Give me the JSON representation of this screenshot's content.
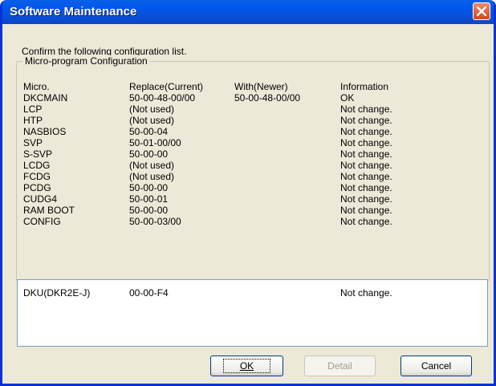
{
  "window": {
    "title": "Software Maintenance"
  },
  "prompt": "Confirm the following configuration list.",
  "group": {
    "legend": "Micro-program Configuration"
  },
  "columns": [
    "Micro.",
    "Replace(Current)",
    "With(Newer)",
    "Information"
  ],
  "rows": [
    [
      "DKCMAIN",
      "50-00-48-00/00",
      "50-00-48-00/00",
      "OK"
    ],
    [
      "LCP",
      "(Not used)",
      "",
      "Not change."
    ],
    [
      "HTP",
      "(Not used)",
      "",
      "Not change."
    ],
    [
      "NASBIOS",
      "50-00-04",
      "",
      "Not change."
    ],
    [
      "SVP",
      "50-01-00/00",
      "",
      "Not change."
    ],
    [
      "S-SVP",
      "50-00-00",
      "",
      "Not change."
    ],
    [
      "LCDG",
      "(Not used)",
      "",
      "Not change."
    ],
    [
      "FCDG",
      "(Not used)",
      "",
      "Not change."
    ],
    [
      "PCDG",
      "50-00-00",
      "",
      "Not change."
    ],
    [
      "CUDG4",
      "50-00-01",
      "",
      "Not change."
    ],
    [
      "RAM BOOT",
      "50-00-00",
      "",
      "Not change."
    ],
    [
      "CONFIG",
      "50-00-03/00",
      "",
      "Not change."
    ]
  ],
  "dku_list": [
    [
      "DKU(DKR2E-J)",
      "00-00-F4",
      "",
      "Not change."
    ]
  ],
  "buttons": {
    "ok_label": "OK",
    "detail_label": "Detail",
    "cancel_label": "Cancel"
  }
}
